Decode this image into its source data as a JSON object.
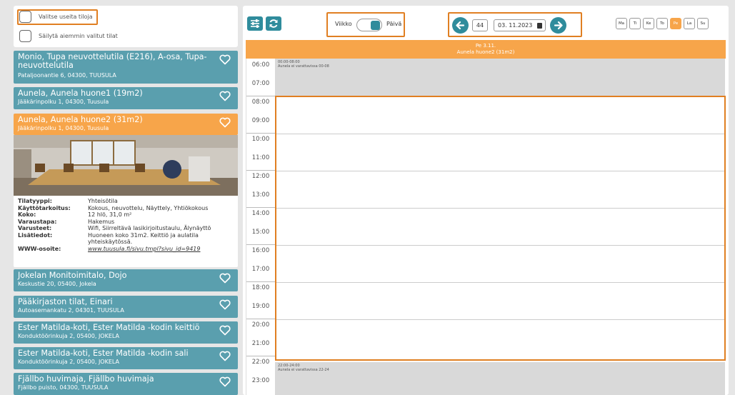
{
  "options": {
    "select_multiple_label": "Valitse useita tiloja",
    "keep_selected_label": "Säilytä aiemmin valitut tilat"
  },
  "rooms": [
    {
      "title": "Monio, Tupa neuvottelutila (E216), A-osa, Tupa-neuvottelutila",
      "address": "Pataljoonantie 6, 04300, TUUSULA"
    },
    {
      "title": "Aunela, Aunela huone1 (19m2)",
      "address": "Jääkärinpolku 1, 04300, Tuusula"
    },
    {
      "title": "Aunela, Aunela huone2 (31m2)",
      "address": "Jääkärinpolku 1, 04300, Tuusula"
    },
    {
      "title": "Jokelan Monitoimitalo, Dojo",
      "address": "Keskustie 20, 05400, Jokela"
    },
    {
      "title": "Pääkirjaston tilat, Einari",
      "address": "Autoasemankatu 2, 04301, TUUSULA"
    },
    {
      "title": "Ester Matilda-koti, Ester Matilda -kodin keittiö",
      "address": "Konduktöörinkuja 2, 05400, JOKELA"
    },
    {
      "title": "Ester Matilda-koti, Ester Matilda -kodin sali",
      "address": "Konduktöörinkuja 2, 05400, JOKELA"
    },
    {
      "title": "Fjällbo huvimaja, Fjällbo huvimaja",
      "address": "Fjällbo puisto, 04300, TUUSULA"
    }
  ],
  "details": [
    {
      "key": "Tilatyyppi:",
      "value": "Yhteisötila"
    },
    {
      "key": "Käyttötarkoitus:",
      "value": "Kokous, neuvottelu, Näyttely, Yhtiökokous"
    },
    {
      "key": "Koko:",
      "value": "12 hlö, 31,0 m²"
    },
    {
      "key": "Varaustapa:",
      "value": "Hakemus"
    },
    {
      "key": "Varusteet:",
      "value": "Wifi, Siirreltävä lasikirjoitustaulu, Älynäyttö"
    },
    {
      "key": "Lisätiedot:",
      "value": "Huoneen koko 31m2. Keittiö ja aulatila yhteiskäytössä."
    },
    {
      "key": "WWW-osoite:",
      "value": "www.tuusula.fi/sivu.tmpl?sivu_id=9419"
    }
  ],
  "toolbar": {
    "week_label": "Viikko",
    "day_label": "Päivä",
    "week_number": "44",
    "date": "03. 11.2023",
    "days": [
      "Ma",
      "Ti",
      "Ke",
      "To",
      "Pe",
      "La",
      "Su"
    ],
    "selected_day": "Pe"
  },
  "calendar": {
    "header_date": "Pe 3.11.",
    "header_room": "Aunela huone2 (31m2)",
    "hours": [
      "06:00",
      "07:00",
      "08:00",
      "09:00",
      "10:00",
      "11:00",
      "12:00",
      "13:00",
      "14:00",
      "15:00",
      "16:00",
      "17:00",
      "18:00",
      "19:00",
      "20:00",
      "21:00",
      "22:00",
      "23:00"
    ],
    "block_morning_time": "00:00-08:00",
    "block_morning_text": "Aunela ei varattavissa 00-08",
    "block_evening_time": "22:00-24:00",
    "block_evening_text": "Aunela ei varattavissa 22-24"
  },
  "colors": {
    "teal": "#5a9fae",
    "orange": "#f7a54a",
    "button": "#2f8c9c",
    "highlight": "#e07f22"
  }
}
